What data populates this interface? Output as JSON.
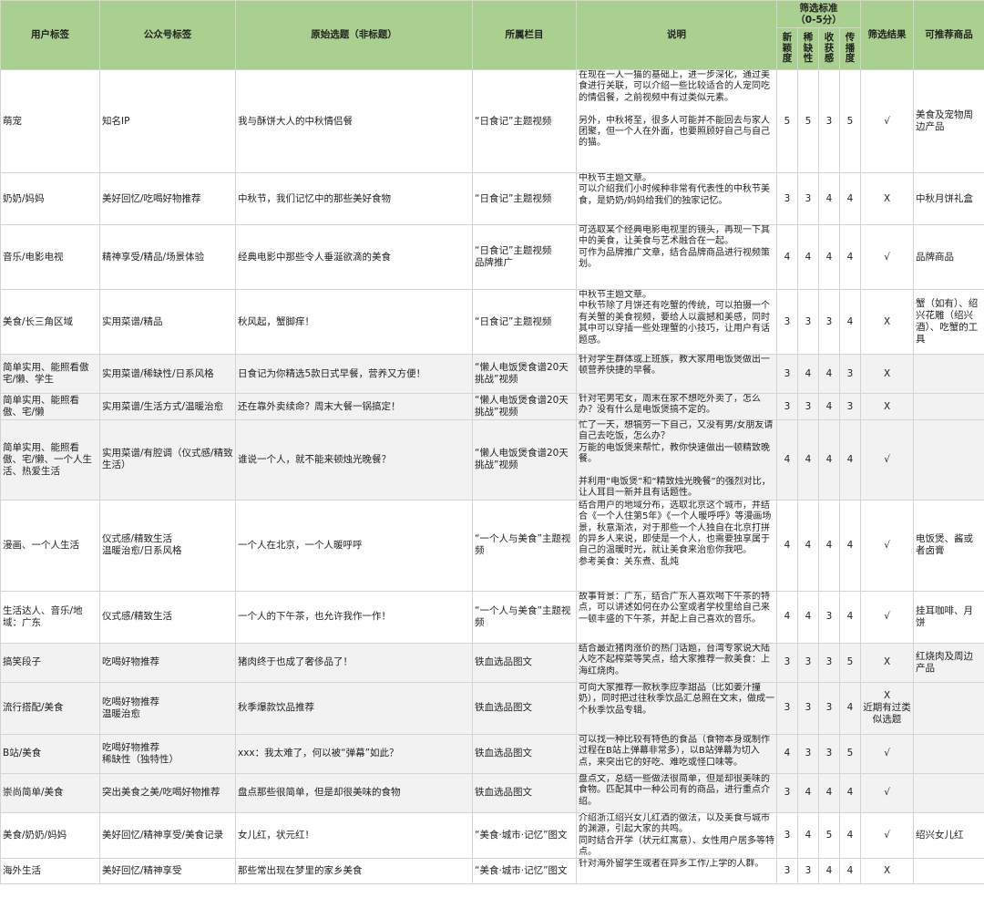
{
  "header": {
    "user_tag": "用户标签",
    "account_tag": "公众号标签",
    "topic": "原始选题（非标题）",
    "column": "所属栏目",
    "desc": "说明",
    "criteria": "筛选标准\n（0-5分）",
    "novelty": "新\n颖\n度",
    "scarcity": "稀\n缺\n性",
    "gain": "收\n获\n感",
    "spread": "传\n播\n度",
    "result": "筛选结果",
    "products": "可推荐商品"
  },
  "rows": [
    {
      "user_tag": "萌宠",
      "account_tag": "知名IP",
      "topic": "我与酥饼大人的中秋情侣餐",
      "column": "“日食记”主题视频",
      "desc": "在现在一人一猫的基础上，进一步深化，通过美食进行关联，可以介绍一些比较适合的人宠同吃的情侣餐，之前视频中有过类似元素。\n\n另外，中秋将至，很多人可能并不能回去与家人团聚，但一个人在外面，也要照顾好自己与自己的猫。",
      "novelty": "5",
      "scarcity": "5",
      "gain": "3",
      "spread": "5",
      "result": "√",
      "products": "美食及宠物周边产品"
    },
    {
      "user_tag": "奶奶/妈妈",
      "account_tag": "美好回忆/吃喝好物推荐",
      "topic": "中秋节，我们记忆中的那些美好食物",
      "column": "“日食记”主题视频",
      "desc": "中秋节主题文章。\n可以介绍我们小时候种非常有代表性的中秋节美食，是奶奶/妈妈给我们的独家记忆。",
      "novelty": "3",
      "scarcity": "3",
      "gain": "4",
      "spread": "4",
      "result": "X",
      "products": "中秋月饼礼盒"
    },
    {
      "user_tag": "音乐/电影电视",
      "account_tag": "精神享受/精品/场景体验",
      "topic": "经典电影中那些令人垂涎欲滴的美食",
      "column": "“日食记”主题视频\n品牌推广",
      "desc": "可选取某个经典电影电视里的镜头，再现一下其中的美食，让美食与艺术融合在一起。\n可作为品牌推广文章，结合品牌商品进行视频策划。",
      "novelty": "4",
      "scarcity": "4",
      "gain": "4",
      "spread": "4",
      "result": "√",
      "products": "品牌商品"
    },
    {
      "user_tag": "美食/长三角区域",
      "account_tag": "实用菜谱/精品",
      "topic": "秋风起，蟹脚痒！",
      "column": "“日食记”主题视频",
      "desc": "中秋节主题文章。\n中秋节除了月饼还有吃蟹的传统，可以拍摄一个有关蟹的美食视频，要给人以震撼和美感，同时其中可以穿插一些处理蟹的小技巧，让用户有话题感。",
      "novelty": "3",
      "scarcity": "3",
      "gain": "3",
      "spread": "4",
      "result": "X",
      "products": "蟹（如有）、绍兴花雕（绍兴酒）、吃蟹的工具"
    },
    {
      "user_tag": "简单实用、能照看傲\n宅/懒、学生",
      "account_tag": "实用菜谱/稀缺性/日系风格",
      "topic": "日食记为你精选5款日式早餐，营养又方便！",
      "column": "“懒人电饭煲食谱20天挑战”视频",
      "desc": "针对学生群体或上班族，教大家用电饭煲做出一顿营养快捷的早餐。",
      "novelty": "3",
      "scarcity": "4",
      "gain": "4",
      "spread": "3",
      "result": "X",
      "products": ""
    },
    {
      "user_tag": "简单实用、能照看傲、宅/懒",
      "account_tag": "实用菜谱/生活方式/温暖治愈",
      "topic": "还在靠外卖续命？周末大餐一锅搞定！",
      "column": "“懒人电饭煲食谱20天挑战”视频",
      "desc": "针对宅男宅女，周末在家不想吃外卖了，怎么办？没有什么是电饭煲搞不定的。",
      "novelty": "3",
      "scarcity": "3",
      "gain": "4",
      "spread": "3",
      "result": "X",
      "products": ""
    },
    {
      "user_tag": "简单实用、能照看傲、宅/懒、一个人生活、热爱生活",
      "account_tag": "实用菜谱/有腔调（仪式感/精致生活）",
      "topic": "谁说一个人，就不能来顿烛光晚餐？",
      "column": "“懒人电饭煲食谱20天挑战”视频",
      "desc": "忙了一天，想犒劳一下自己，又没有男/女朋友请自己去吃饭，怎么办？\n万能的电饭煲来帮忙，教你快速做出一顿精致晚餐。\n\n并利用“电饭煲”和“精致烛光晚餐”的强烈对比，让人耳目一新并且有话题性。",
      "novelty": "4",
      "scarcity": "4",
      "gain": "4",
      "spread": "4",
      "result": "√",
      "products": ""
    },
    {
      "user_tag": "漫画、一个人生活",
      "account_tag": "仪式感/精致生活\n温暖治愈/日系风格",
      "topic": "一个人在北京，一个人暖呼呼",
      "column": "“一个人与美食”主题视频",
      "desc": "结合用户的地域分布，选取北京这个城市，并结合《一个人住第5年》《一个人暖呼呼》等漫画场景，秋意渐浓，对于那些一个人独自在北京打拼的异乡人来说，即使是一个人，也需要独享属于自己的温暖时光，就让美食来治愈你我吧。\n参考美食：关东煮、乱炖",
      "novelty": "4",
      "scarcity": "4",
      "gain": "4",
      "spread": "4",
      "result": "√",
      "products": "电饭煲、酱或者卤膏"
    },
    {
      "user_tag": "生活达人、音乐/地域：广东",
      "account_tag": "仪式感/精致生活",
      "topic": "一个人的下午茶，也允许我作一作！",
      "column": "“一个人与美食”主题视频",
      "desc": "故事背景：广东，结合广东人喜欢喝下午茶的特点，可以讲述如何在办公室或者学校里给自己来一顿丰盛的下午茶，并配上自己喜欢的音乐。",
      "novelty": "4",
      "scarcity": "4",
      "gain": "3",
      "spread": "4",
      "result": "√",
      "products": "挂耳咖啡、月饼"
    },
    {
      "user_tag": "搞笑段子",
      "account_tag": "吃喝好物推荐",
      "topic": "猪肉终于也成了奢侈品了！",
      "column": "铁血选品图文",
      "desc": "结合最近猪肉涨价的热门话题，台湾专家说大陆人吃不起榨菜等笑点，给大家推荐一款美食：上海红烧肉。",
      "novelty": "3",
      "scarcity": "3",
      "gain": "3",
      "spread": "5",
      "result": "X",
      "products": "红烧肉及周边产品"
    },
    {
      "user_tag": "流行搭配/美食",
      "account_tag": "吃喝好物推荐\n温暖治愈",
      "topic": "秋季爆款饮品推荐",
      "column": "铁血选品图文",
      "desc": "可向大家推荐一款秋季应季甜品（比如姜汁撞奶），同时把过往秋季饮品汇总照在文末，做成一个秋季饮品专辑。",
      "novelty": "3",
      "scarcity": "3",
      "gain": "3",
      "spread": "4",
      "result": "X\n近期有过类似选题",
      "products": ""
    },
    {
      "user_tag": "B站/美食",
      "account_tag": "吃喝好物推荐\n稀缺性（独特性）",
      "topic": "xxx：我太难了，何以被“弹幕”如此？",
      "column": "铁血选品图文",
      "desc": "可以找一种比较有特色的食品（食物本身或制作过程在B站上弹幕非常多），以B站弹幕为切入点，来突出它的好吃、难吃或怪口味等。",
      "novelty": "4",
      "scarcity": "3",
      "gain": "3",
      "spread": "5",
      "result": "√",
      "products": ""
    },
    {
      "user_tag": "崇尚简单/美食",
      "account_tag": "突出美食之美/吃喝好物推荐",
      "topic": "盘点那些很简单，但是却很美味的食物",
      "column": "铁血选品图文",
      "desc": "盘点文，总结一些做法很简单，但是却很美味的食物。匹配其中一种公司有的商品，进行重点介绍。",
      "novelty": "3",
      "scarcity": "4",
      "gain": "4",
      "spread": "4",
      "result": "√",
      "products": ""
    },
    {
      "user_tag": "美食/奶奶/妈妈",
      "account_tag": "美好回忆/精神享受/美食记录",
      "topic": "女儿红，状元红！",
      "column": "“美食·城市·记忆”图文",
      "desc": "介绍浙江绍兴女儿红酒的做法，以及美食与城市的渊源，引起大家的共鸣。\n同时结合开学（状元红寓意）、女性用户居多等特点。",
      "novelty": "3",
      "scarcity": "4",
      "gain": "5",
      "spread": "4",
      "result": "√",
      "products": "绍兴女儿红"
    },
    {
      "user_tag": "海外生活",
      "account_tag": "美好回忆/精神享受",
      "topic": "那些常出现在梦里的家乡美食",
      "column": "“美食·城市·记忆”图文",
      "desc": "针对海外留学生或者在异乡工作/上学的人群。",
      "novelty": "3",
      "scarcity": "3",
      "gain": "4",
      "spread": "4",
      "result": "X",
      "products": ""
    }
  ]
}
